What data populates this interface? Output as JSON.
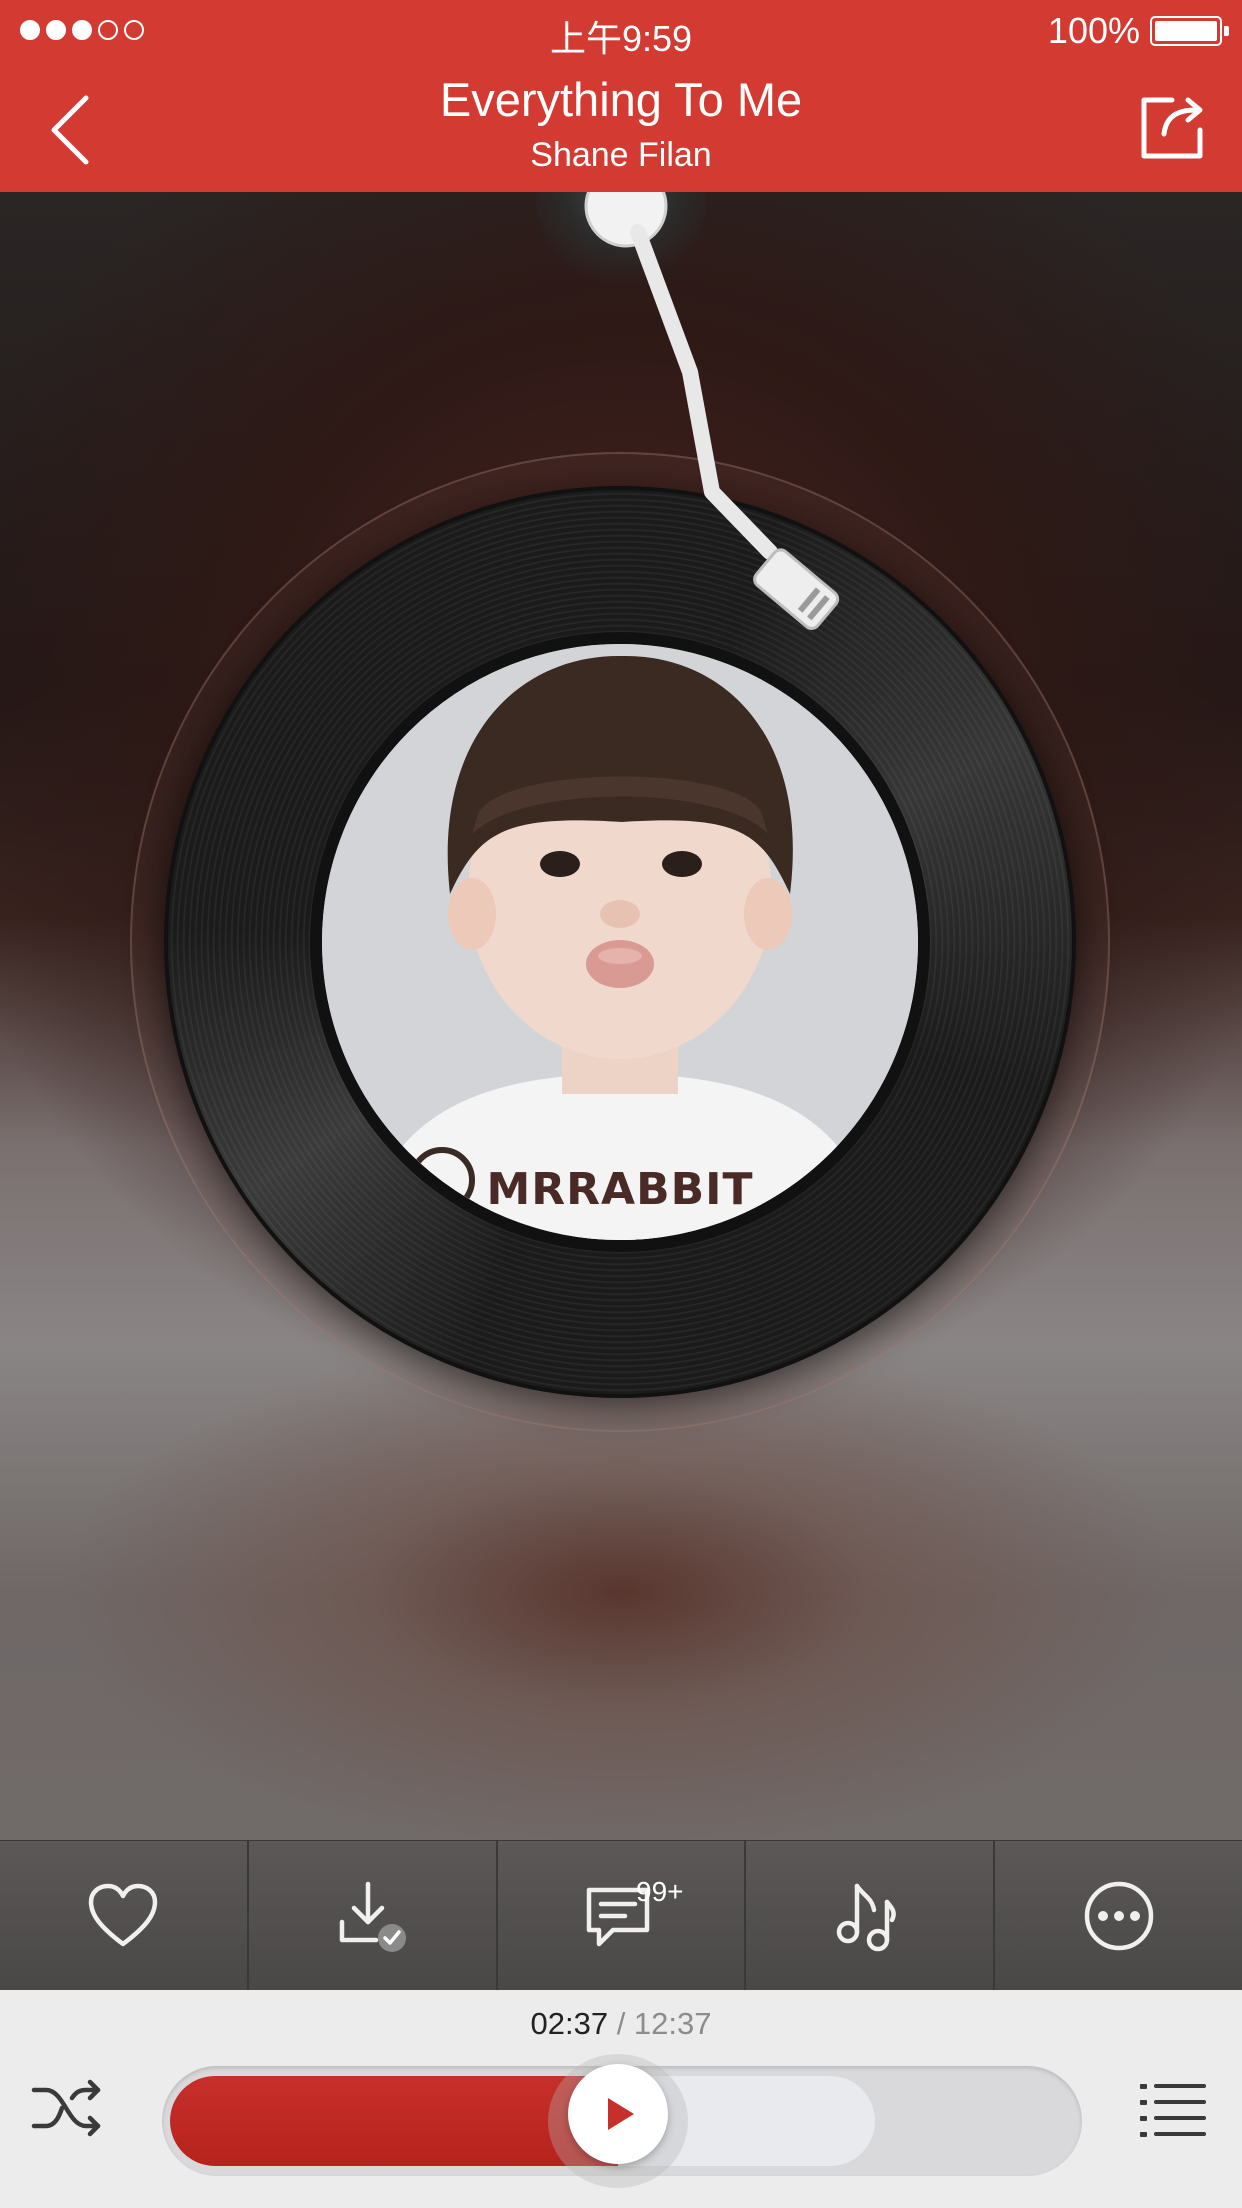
{
  "status_bar": {
    "signal_dots": [
      true,
      true,
      true,
      false,
      false
    ],
    "time": "上午9:59",
    "battery_percent": "100%",
    "battery_level": 1.0
  },
  "header": {
    "background": "#d33a31",
    "back_icon": "chevron-left-icon",
    "title": "Everything To Me",
    "artist": "Shane Filan",
    "share_icon": "share-icon"
  },
  "artwork": {
    "brand_text": "MRRABBIT"
  },
  "actions": [
    {
      "icon": "heart-icon",
      "label": ""
    },
    {
      "icon": "download-done-icon",
      "label": ""
    },
    {
      "icon": "comment-icon",
      "label": ""
    },
    {
      "icon": "music-note-icon",
      "label": ""
    },
    {
      "icon": "more-icon",
      "label": ""
    }
  ],
  "comment_badge": "99+",
  "player": {
    "current_time": "02:37",
    "separator": " / ",
    "total_time": "12:37",
    "progress": 0.496,
    "buffered": 0.78,
    "accent": "#c62f2a",
    "shuffle_icon": "shuffle-icon",
    "play_icon": "play-icon",
    "playlist_icon": "playlist-icon"
  }
}
